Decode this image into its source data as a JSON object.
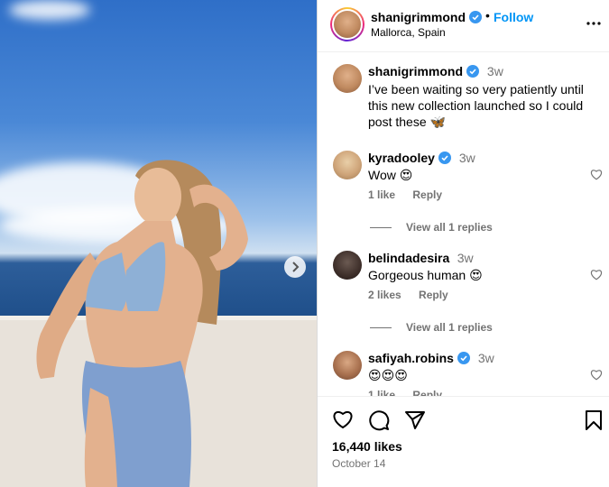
{
  "post": {
    "username": "shanigrimmond",
    "follow_label": "Follow",
    "dot": "•",
    "location": "Mallorca, Spain",
    "caption_time": "3w",
    "caption": "I’ve been waiting so very patiently until this new collection launched so I could post these 🦋"
  },
  "comments": [
    {
      "username": "kyradooley",
      "time": "3w",
      "text": "Wow 😍",
      "likes": "1 like",
      "reply": "Reply",
      "view_replies": "View all 1 replies"
    },
    {
      "username": "belindadesira",
      "time": "3w",
      "text": "Gorgeous human 😍",
      "likes": "2 likes",
      "reply": "Reply",
      "view_replies": "View all 1 replies"
    },
    {
      "username": "safiyah.robins",
      "time": "3w",
      "text": "😍😍😍",
      "likes": "1 like",
      "reply": "Reply"
    }
  ],
  "footer": {
    "likes": "16,440 likes",
    "date": "October 14"
  },
  "icons": {
    "verified": "verified-badge-icon",
    "more": "more-options-icon",
    "heart": "heart-icon",
    "comment": "comment-icon",
    "share": "share-icon",
    "save": "bookmark-icon",
    "next": "chevron-right-icon"
  },
  "colors": {
    "accent": "#0095f6",
    "muted": "#737373",
    "verified": "#3897f0"
  }
}
